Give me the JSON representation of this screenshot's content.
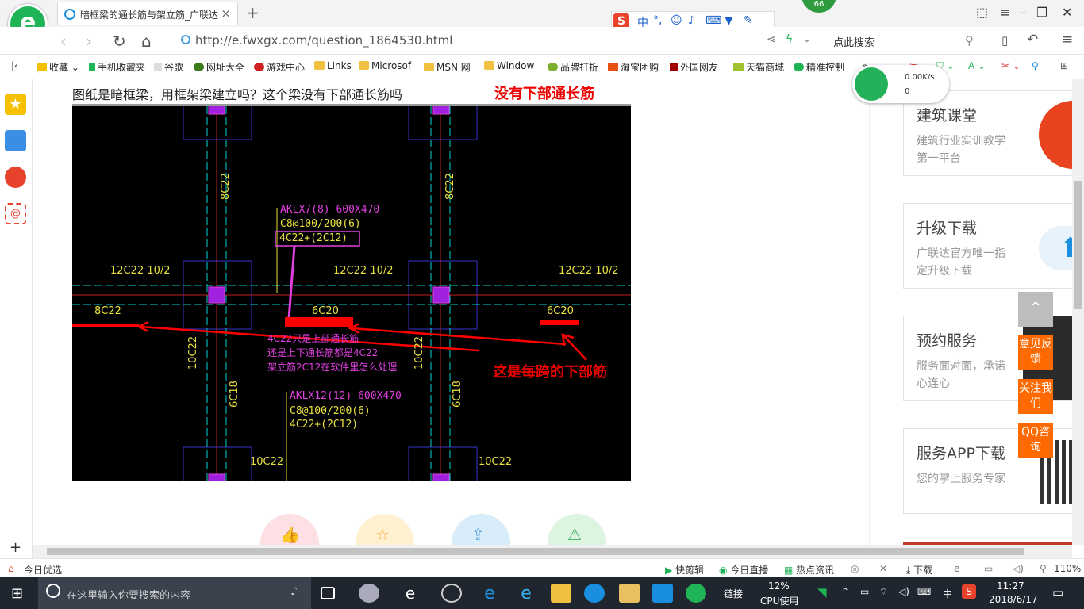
{
  "browser": {
    "tab_title": "暗框梁的通长筋与架立筋_广联达",
    "url": "http://e.fwxgx.com/question_1864530.html",
    "search_placeholder": "点此搜索",
    "badge_count": "66",
    "bookmarks": [
      "收藏",
      "手机收藏夹",
      "谷歌",
      "网址大全",
      "游戏中心",
      "Links",
      "Microsof",
      "MSN 网",
      "Window",
      "品牌打折",
      "淘宝团购",
      "外国网友",
      "天猫商城",
      "精准控制"
    ],
    "bookmark_more": "»",
    "speed": {
      "rate": "0.00K/s",
      "count": "0"
    }
  },
  "page": {
    "question": "图纸是暗框梁，用框架梁建立吗？这个梁没有下部通长筋吗",
    "annotation_top": "没有下部通长筋",
    "annotation_bottom": "这是每跨的下部筋"
  },
  "cad": {
    "beam1": [
      "AKLX7(8) 600X470",
      "C8@100/200(6)",
      "4C22+(2C12)"
    ],
    "beam2": [
      "AKLX12(12) 600X470",
      "C8@100/200(6)",
      "4C22+(2C12)"
    ],
    "top_bars": [
      "12C22 10/2",
      "12C22 10/2",
      "12C22 10/2"
    ],
    "bottom_bars": [
      "8C22",
      "6C20",
      "6C20"
    ],
    "vertical_labels": [
      "8C22",
      "8C22",
      "10C22",
      "10C22",
      "6C18",
      "6C18"
    ],
    "bottom_labels": [
      "10C22",
      "10C22"
    ],
    "question_note": [
      "4C22只是上部通长筋",
      "还是上下通长筋都是4C22",
      "架立筋2C12在软件里怎么处理"
    ]
  },
  "right_panel": {
    "cards": [
      {
        "title": "建筑课堂",
        "subtitle": "建筑行业实训教学第一平台"
      },
      {
        "title": "升级下载",
        "subtitle": "广联达官方唯一指定升级下载"
      },
      {
        "title": "预约服务",
        "subtitle": "服务面对面，承诺心连心"
      },
      {
        "title": "服务APP下载",
        "subtitle": "您的掌上服务专家"
      }
    ],
    "float_buttons": [
      "意见反馈",
      "关注我们",
      "QQ咨询"
    ]
  },
  "statusbar": {
    "left": "今日优选",
    "items": [
      "快剪辑",
      "今日直播",
      "热点资讯",
      "下载"
    ],
    "zoom": "110%"
  },
  "taskbar": {
    "search_placeholder": "在这里输入你要搜索的内容",
    "link_label": "链接",
    "cpu_percent": "12%",
    "cpu_label": "CPU使用",
    "ime": "中",
    "time": "11:27",
    "date": "2018/6/17"
  },
  "colors": {
    "accent_green": "#1fb456",
    "annotation_red": "#e00000",
    "float_orange": "#ff6a00",
    "cad_magenta": "#e040e0",
    "cad_yellow": "#e8e040"
  }
}
